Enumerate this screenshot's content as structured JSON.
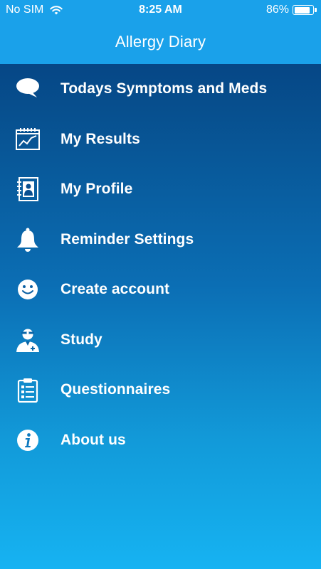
{
  "status_bar": {
    "carrier": "No SIM",
    "time": "8:25 AM",
    "battery": "86%",
    "battery_level": 0.86
  },
  "nav": {
    "title": "Allergy Diary"
  },
  "menu": {
    "items": [
      {
        "label": "Todays Symptoms and Meds",
        "icon": "speech-bubble-icon"
      },
      {
        "label": "My Results",
        "icon": "chart-calendar-icon"
      },
      {
        "label": "My Profile",
        "icon": "contact-book-icon"
      },
      {
        "label": "Reminder Settings",
        "icon": "bell-icon"
      },
      {
        "label": "Create account",
        "icon": "smiley-icon"
      },
      {
        "label": "Study",
        "icon": "doctor-icon"
      },
      {
        "label": "Questionnaires",
        "icon": "clipboard-icon"
      },
      {
        "label": "About us",
        "icon": "info-icon"
      }
    ]
  },
  "colors": {
    "header": "#1aa1ea",
    "gradient_top": "#053a7a",
    "gradient_bottom": "#16b3f2",
    "text": "#ffffff"
  }
}
